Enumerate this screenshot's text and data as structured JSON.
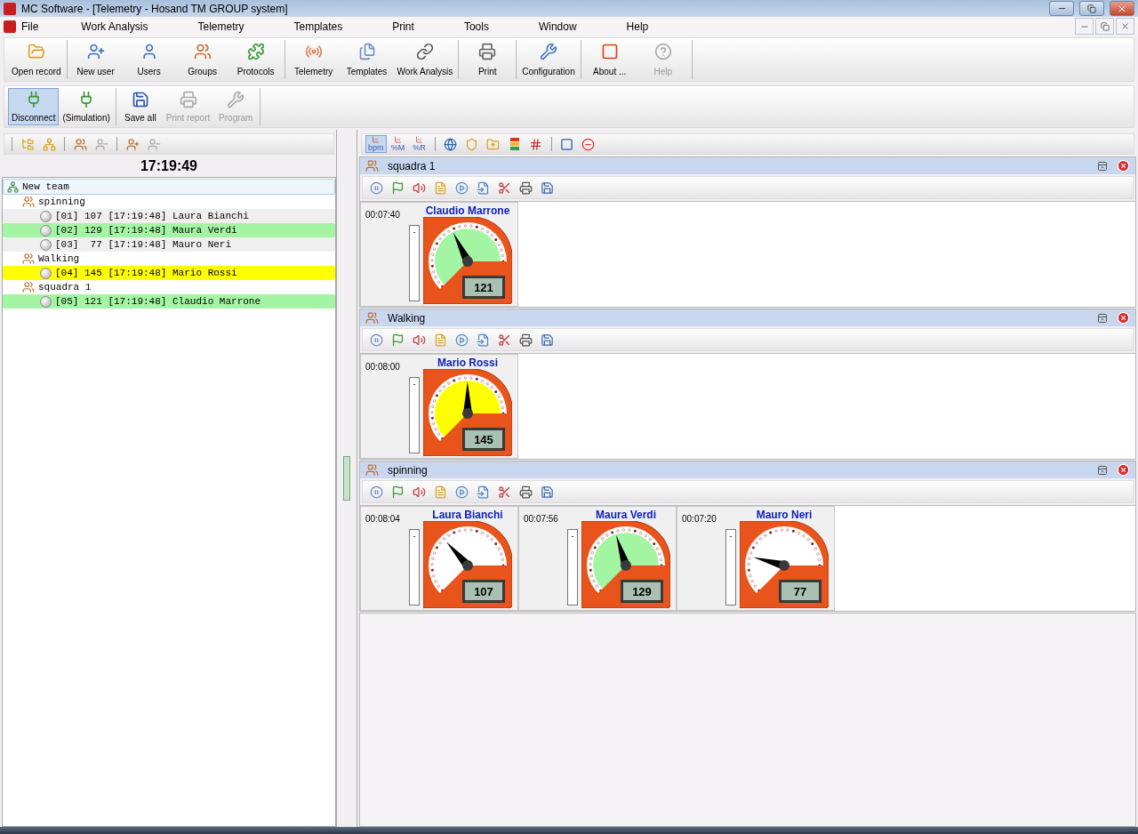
{
  "window": {
    "title": "MC Software - [Telemetry - Hosand TM GROUP system]"
  },
  "menu": [
    "File",
    "Work Analysis",
    "Telemetry",
    "Templates",
    "Print",
    "Tools",
    "Window",
    "Help"
  ],
  "main_toolbar": [
    [
      {
        "label": "Open record",
        "disabled": false
      }
    ],
    [
      {
        "label": "New user",
        "disabled": false
      },
      {
        "label": "Users",
        "disabled": false
      },
      {
        "label": "Groups",
        "disabled": false
      },
      {
        "label": "Protocols",
        "disabled": false
      }
    ],
    [
      {
        "label": "Telemetry",
        "disabled": false
      },
      {
        "label": "Templates",
        "disabled": false
      },
      {
        "label": "Work Analysis",
        "disabled": false
      }
    ],
    [
      {
        "label": "Print",
        "disabled": false
      }
    ],
    [
      {
        "label": "Configuration",
        "disabled": false
      }
    ],
    [
      {
        "label": "About ...",
        "disabled": false
      },
      {
        "label": "Help",
        "disabled": true
      }
    ]
  ],
  "session_toolbar": [
    [
      {
        "label": "Disconnect",
        "selected": true,
        "disabled": false
      },
      {
        "label": "(Simulation)",
        "selected": false,
        "disabled": false
      }
    ],
    [
      {
        "label": "Save all",
        "selected": false,
        "disabled": false
      },
      {
        "label": "Print report",
        "selected": false,
        "disabled": true
      },
      {
        "label": "Program",
        "selected": false,
        "disabled": true
      }
    ]
  ],
  "team_toolbar": [
    [
      {
        "disabled": false
      },
      {
        "disabled": false
      }
    ],
    [
      {
        "disabled": false
      },
      {
        "disabled": true
      }
    ],
    [
      {
        "disabled": false
      },
      {
        "disabled": true
      }
    ]
  ],
  "clock": "17:19:49",
  "tree": {
    "label": "New team",
    "children": [
      {
        "label": "spinning",
        "children": [
          {
            "label": "[01] 107 [17:19:48] Laura Bianchi",
            "color": "#efefef"
          },
          {
            "label": "[02] 129 [17:19:48] Maura Verdi",
            "color": "#a3f5a3"
          },
          {
            "label": "[03]  77 [17:19:48] Mauro Neri",
            "color": "#efefef"
          }
        ]
      },
      {
        "label": "Walking",
        "children": [
          {
            "label": "[04] 145 [17:19:48] Mario Rossi",
            "color": "#ffff00"
          }
        ]
      },
      {
        "label": "squadra 1",
        "children": [
          {
            "label": "[05] 121 [17:19:48] Claudio Marrone",
            "color": "#a3f5a3"
          }
        ]
      }
    ]
  },
  "view_toolbar": {
    "modes": [
      {
        "label": "bpm",
        "selected": true
      },
      {
        "label": "%M",
        "selected": false
      },
      {
        "label": "%R",
        "selected": false
      }
    ]
  },
  "groups": [
    {
      "name": "squadra 1",
      "athletes": [
        {
          "name": "Claudio Marrone",
          "elapsed": "00:07:40",
          "meter_mark": "-",
          "hr": "121",
          "color": "#a3f5a3"
        }
      ]
    },
    {
      "name": "Walking",
      "athletes": [
        {
          "name": "Mario Rossi",
          "elapsed": "00:08:00",
          "meter_mark": "-",
          "hr": "145",
          "color": "#ffff00"
        }
      ]
    },
    {
      "name": "spinning",
      "athletes": [
        {
          "name": "Laura Bianchi",
          "elapsed": "00:08:04",
          "meter_mark": "-",
          "hr": "107",
          "color": "#ffffff"
        },
        {
          "name": "Maura Verdi",
          "elapsed": "00:07:56",
          "meter_mark": "-",
          "hr": "129",
          "color": "#a3f5a3"
        },
        {
          "name": "Mauro Neri",
          "elapsed": "00:07:20",
          "meter_mark": "-",
          "hr": "77",
          "color": "#ffffff"
        }
      ]
    }
  ]
}
